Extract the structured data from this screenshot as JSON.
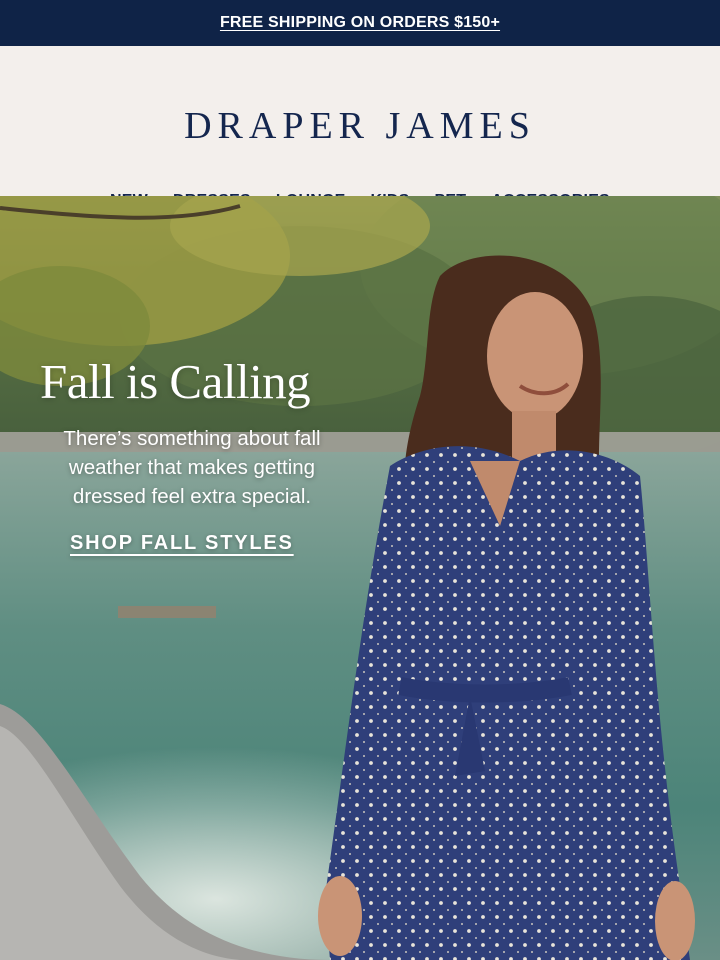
{
  "promo_bar": {
    "text": "FREE SHIPPING ON ORDERS $150+"
  },
  "header": {
    "brand": "DRAPER JAMES",
    "nav": [
      "NEW",
      "DRESSES",
      "LOUNGE",
      "KIDS",
      "PET",
      "ACCESSORIES"
    ]
  },
  "hero": {
    "headline": "Fall is Calling",
    "subhead": "There’s something about fall weather that makes getting dressed feel extra special.",
    "cta": "SHOP FALL STYLES",
    "image_alt_icon": "hero-photo"
  },
  "colors": {
    "navy": "#0f2347",
    "brand_text": "#14264e",
    "header_bg": "#f3efec",
    "dress": "#2f3f7a"
  }
}
